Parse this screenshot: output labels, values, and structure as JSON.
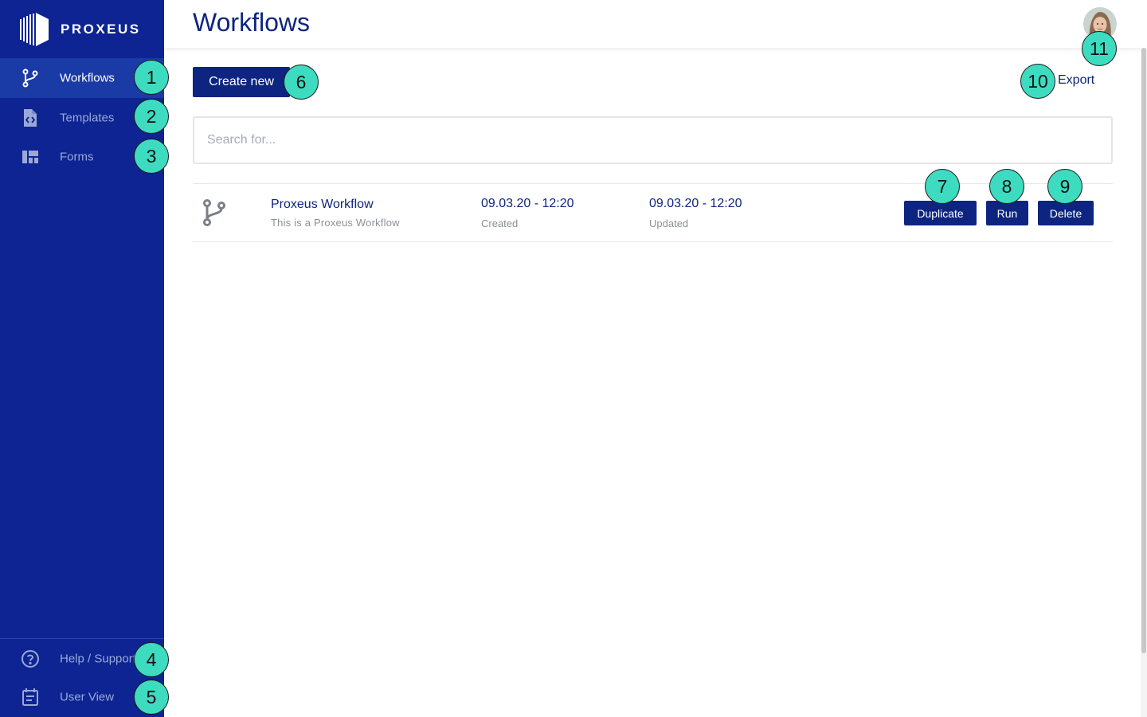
{
  "app": {
    "brand": "PROXEUS"
  },
  "sidebar": {
    "items": [
      {
        "label": "Workflows",
        "icon": "workflow-icon",
        "active": true
      },
      {
        "label": "Templates",
        "icon": "template-file-icon",
        "active": false
      },
      {
        "label": "Forms",
        "icon": "forms-grid-icon",
        "active": false
      }
    ],
    "bottom_items": [
      {
        "label": "Help / Support",
        "icon": "help-circle-icon"
      },
      {
        "label": "User View",
        "icon": "calendar-icon"
      }
    ]
  },
  "header": {
    "title": "Workflows",
    "avatar": "user-avatar"
  },
  "toolbar": {
    "create_label": "Create new",
    "export_label": "Export"
  },
  "search": {
    "placeholder": "Search for..."
  },
  "workflows": [
    {
      "name": "Proxeus Workflow",
      "description": "This is a Proxeus Workflow",
      "created": "09.03.20 - 12:20",
      "created_label": "Created",
      "updated": "09.03.20 - 12:20",
      "updated_label": "Updated",
      "actions": {
        "duplicate": "Duplicate",
        "run": "Run",
        "delete": "Delete"
      }
    }
  ],
  "markers": [
    "1",
    "2",
    "3",
    "4",
    "5",
    "6",
    "7",
    "8",
    "9",
    "10",
    "11"
  ],
  "colors": {
    "sidebar": "#0d2492",
    "primary": "#0d2580",
    "marker": "#3ddcc0"
  }
}
